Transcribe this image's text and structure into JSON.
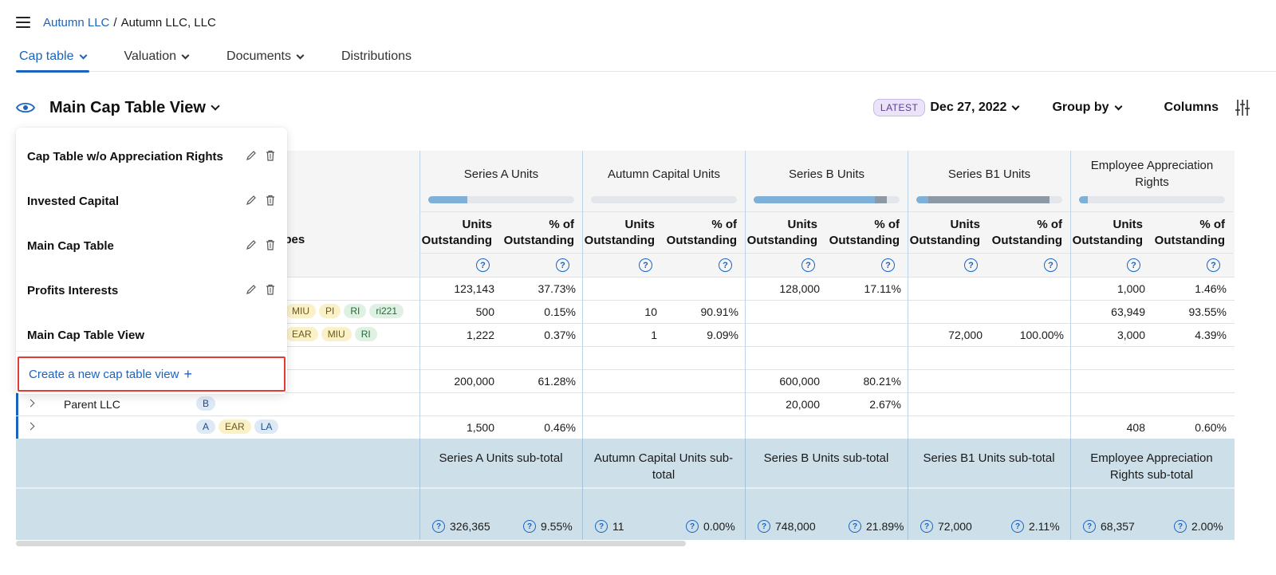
{
  "breadcrumb": {
    "parent": "Autumn LLC",
    "separator": "/",
    "current": "Autumn LLC, LLC"
  },
  "tabs": [
    {
      "label": "Cap table",
      "active": true,
      "has_menu": true
    },
    {
      "label": "Valuation",
      "has_menu": true
    },
    {
      "label": "Documents",
      "has_menu": true
    },
    {
      "label": "Distributions",
      "has_menu": false
    }
  ],
  "view": {
    "title": "Main Cap Table View"
  },
  "controls": {
    "latest_badge": "LATEST",
    "date": "Dec 27, 2022",
    "group_by": "Group by",
    "columns": "Columns"
  },
  "dropdown": {
    "items": [
      {
        "label": "Cap Table w/o Appreciation Rights",
        "editable": true
      },
      {
        "label": "Invested Capital",
        "editable": true
      },
      {
        "label": "Main Cap Table",
        "editable": true
      },
      {
        "label": "Profits Interests",
        "editable": true
      },
      {
        "label": "Main Cap Table View",
        "editable": false
      }
    ],
    "create_label": "Create a new cap table view",
    "create_icon": "+"
  },
  "table": {
    "left_header_partial": "ypes",
    "sub_headers": {
      "units": "Units Outstanding",
      "pct": "% of Outstanding"
    },
    "help_glyph": "?",
    "groups": [
      {
        "title": "Series A Units",
        "bar_fill": 0.27,
        "bar_fill2": 0
      },
      {
        "title": "Autumn Capital Units",
        "bar_fill": 0,
        "bar_fill2": 0
      },
      {
        "title": "Series B Units",
        "bar_fill": 0.83,
        "bar_fill2": 0.08
      },
      {
        "title": "Series B1 Units",
        "bar_fill": 0.08,
        "bar_fill2": 0.83
      },
      {
        "title": "Employee Appreciation Rights",
        "bar_fill": 0.06,
        "bar_fill2": 0
      }
    ],
    "rows": [
      {
        "name": "",
        "tags": [],
        "accent": false,
        "expander": false,
        "cells": [
          [
            "123,143",
            "37.73%"
          ],
          [
            "",
            ""
          ],
          [
            "128,000",
            "17.11%"
          ],
          [
            "",
            ""
          ],
          [
            "1,000",
            "1.46%"
          ]
        ]
      },
      {
        "name": "",
        "tags": [
          {
            "t": "MIU",
            "c": "yellow"
          },
          {
            "t": "PI",
            "c": "yellow"
          },
          {
            "t": "RI",
            "c": "green"
          },
          {
            "t": "ri221",
            "c": "green"
          }
        ],
        "accent": false,
        "expander": false,
        "cells": [
          [
            "500",
            "0.15%"
          ],
          [
            "10",
            "90.91%"
          ],
          [
            "",
            ""
          ],
          [
            "",
            ""
          ],
          [
            "63,949",
            "93.55%"
          ]
        ]
      },
      {
        "name": "",
        "tags": [
          {
            "t": "EAR",
            "c": "yellow"
          },
          {
            "t": "MIU",
            "c": "yellow"
          },
          {
            "t": "RI",
            "c": "green"
          }
        ],
        "accent": false,
        "expander": false,
        "cells": [
          [
            "1,222",
            "0.37%"
          ],
          [
            "1",
            "9.09%"
          ],
          [
            "",
            ""
          ],
          [
            "72,000",
            "100.00%"
          ],
          [
            "3,000",
            "4.39%"
          ]
        ]
      },
      {
        "name": "",
        "tags": [],
        "accent": false,
        "expander": false,
        "cells": [
          [
            "",
            ""
          ],
          [
            "",
            ""
          ],
          [
            "",
            ""
          ],
          [
            "",
            ""
          ],
          [
            "",
            ""
          ]
        ]
      },
      {
        "name": "",
        "tags": [],
        "accent": false,
        "expander": false,
        "cells": [
          [
            "200,000",
            "61.28%"
          ],
          [
            "",
            ""
          ],
          [
            "600,000",
            "80.21%"
          ],
          [
            "",
            ""
          ],
          [
            "",
            ""
          ]
        ]
      },
      {
        "name": "Parent LLC",
        "tags": [
          {
            "t": "B",
            "c": "blue"
          }
        ],
        "accent": true,
        "expander": true,
        "cells": [
          [
            "",
            ""
          ],
          [
            "",
            ""
          ],
          [
            "20,000",
            "2.67%"
          ],
          [
            "",
            ""
          ],
          [
            "",
            ""
          ]
        ]
      },
      {
        "name": "",
        "tags": [
          {
            "t": "A",
            "c": "blue"
          },
          {
            "t": "EAR",
            "c": "yellow"
          },
          {
            "t": "LA",
            "c": "blue"
          }
        ],
        "accent": true,
        "expander": true,
        "cells": [
          [
            "1,500",
            "0.46%"
          ],
          [
            "",
            ""
          ],
          [
            "",
            ""
          ],
          [
            "",
            ""
          ],
          [
            "408",
            "0.60%"
          ]
        ]
      }
    ],
    "subtotals": [
      {
        "title": "Series A Units sub-total",
        "units": "326,365",
        "pct": "9.55%"
      },
      {
        "title": "Autumn Capital Units sub-total",
        "units": "11",
        "pct": "0.00%"
      },
      {
        "title": "Series B Units sub-total",
        "units": "748,000",
        "pct": "21.89%"
      },
      {
        "title": "Series B1 Units sub-total",
        "units": "72,000",
        "pct": "2.11%"
      },
      {
        "title": "Employee Appreciation Rights sub-total",
        "units": "68,357",
        "pct": "2.00%"
      }
    ]
  },
  "colors": {
    "accent": "#1a64c0",
    "highlight_border": "#e53935",
    "subtotal_bg": "#cde0ea"
  }
}
